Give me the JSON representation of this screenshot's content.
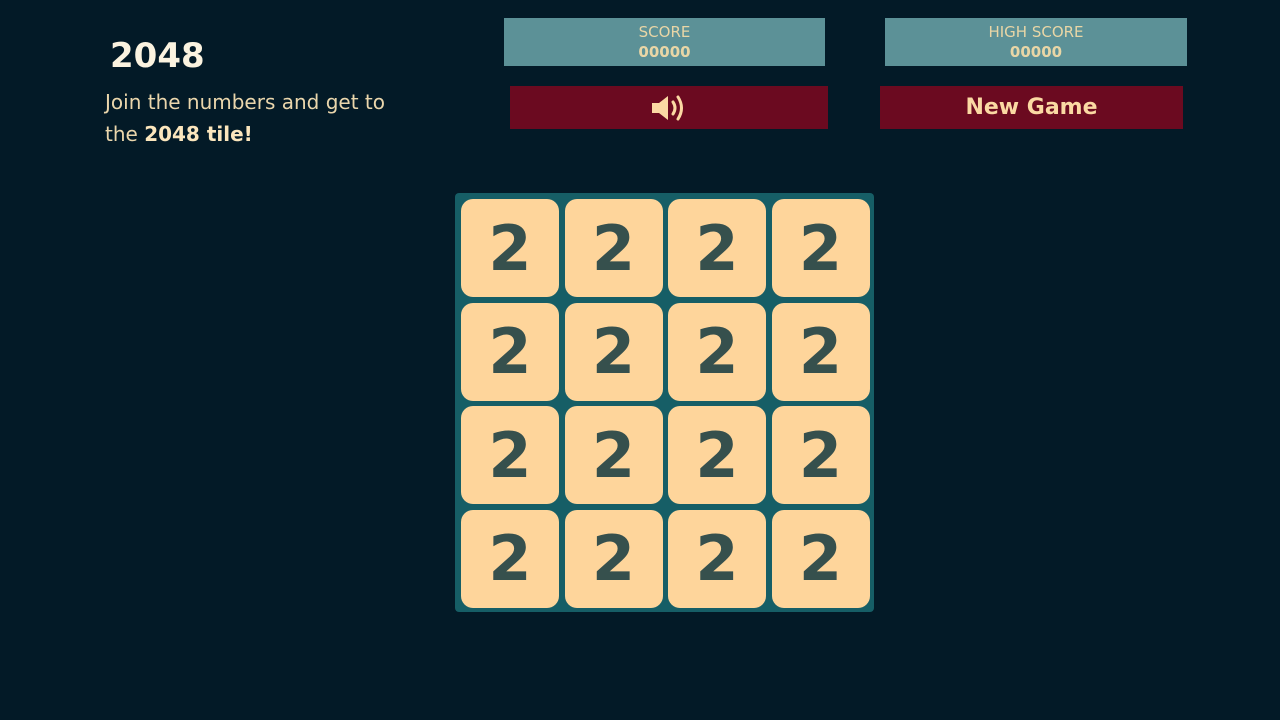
{
  "header": {
    "title": "2048",
    "subtitle_prefix": "Join the numbers and get to the ",
    "subtitle_bold": "2048 tile!"
  },
  "score": {
    "label": "SCORE",
    "value": "00000"
  },
  "high_score": {
    "label": "HIGH SCORE",
    "value": "00000"
  },
  "buttons": {
    "sound_icon": "speaker-volume-icon",
    "new_game": "New Game"
  },
  "board": {
    "size": 4,
    "tiles": [
      [
        "2",
        "2",
        "2",
        "2"
      ],
      [
        "2",
        "2",
        "2",
        "2"
      ],
      [
        "2",
        "2",
        "2",
        "2"
      ],
      [
        "2",
        "2",
        "2",
        "2"
      ]
    ]
  }
}
